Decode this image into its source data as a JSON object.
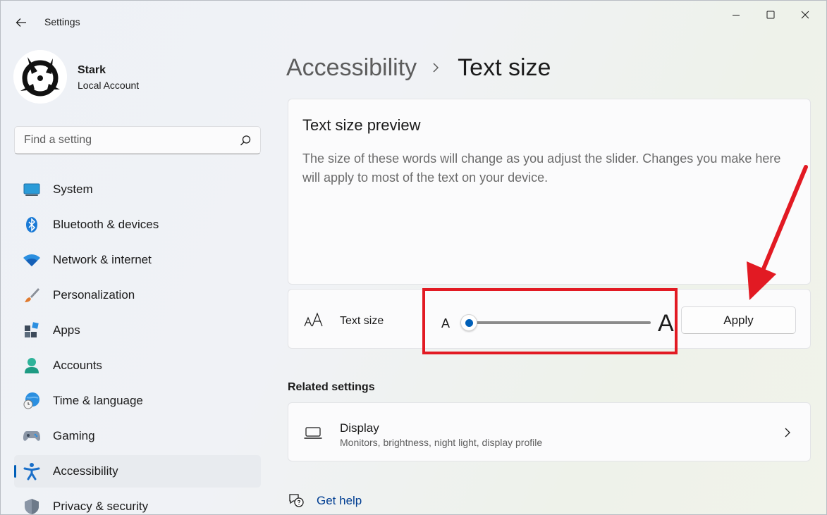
{
  "window": {
    "title": "Settings"
  },
  "profile": {
    "name": "Stark",
    "account_type": "Local Account"
  },
  "search": {
    "placeholder": "Find a setting"
  },
  "nav": {
    "items": [
      {
        "label": "System",
        "icon": "system-icon"
      },
      {
        "label": "Bluetooth & devices",
        "icon": "bluetooth-icon"
      },
      {
        "label": "Network & internet",
        "icon": "wifi-icon"
      },
      {
        "label": "Personalization",
        "icon": "paintbrush-icon"
      },
      {
        "label": "Apps",
        "icon": "apps-icon"
      },
      {
        "label": "Accounts",
        "icon": "person-icon"
      },
      {
        "label": "Time & language",
        "icon": "globe-clock-icon"
      },
      {
        "label": "Gaming",
        "icon": "gamepad-icon"
      },
      {
        "label": "Accessibility",
        "icon": "accessibility-icon",
        "active": true
      },
      {
        "label": "Privacy & security",
        "icon": "shield-icon"
      }
    ]
  },
  "breadcrumb": {
    "parent": "Accessibility",
    "current": "Text size"
  },
  "preview": {
    "title": "Text size preview",
    "text": "The size of these words will change as you adjust the slider. Changes you make here will apply to most of the text on your device."
  },
  "text_size": {
    "label": "Text size",
    "slider_min_label": "A",
    "slider_max_label": "A",
    "slider_fraction": 0.0,
    "apply_label": "Apply"
  },
  "related": {
    "title": "Related settings",
    "display": {
      "title": "Display",
      "subtitle": "Monitors, brightness, night light, display profile"
    }
  },
  "help": {
    "label": "Get help"
  },
  "colors": {
    "accent": "#005fb8",
    "annotation_red": "#e21a23"
  }
}
